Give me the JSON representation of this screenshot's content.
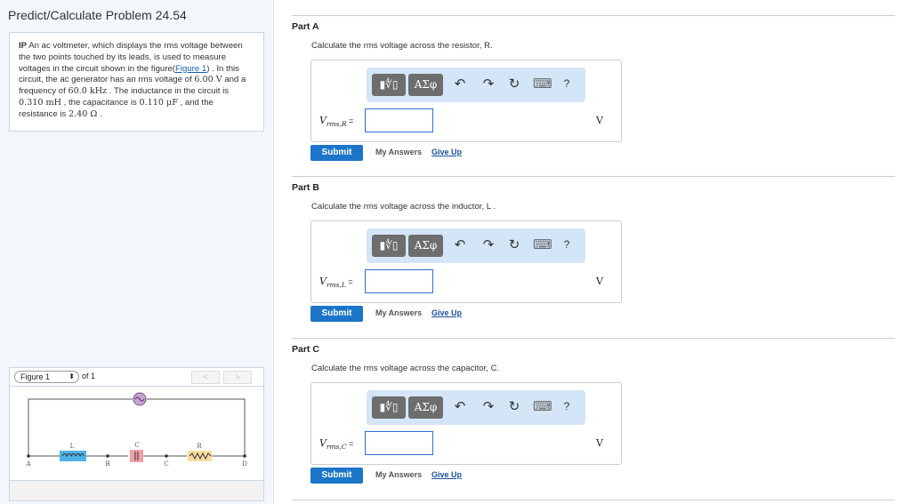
{
  "title": "Predict/Calculate Problem 24.54",
  "problem": {
    "prefix": "IP",
    "t1": " An ac voltmeter, which displays the rms voltage between the two points touched by its leads, is used to measure voltages in the circuit shown in the figure(",
    "link": "Figure 1",
    "t2": ") . In this circuit, the ac generator has an rms voltage of ",
    "v": "6.00 V",
    "t3": " and a frequency of ",
    "f": "60.0 kHz",
    "t4": " . The inductance in the circuit is ",
    "L": "0.310 mH",
    "t5": " , the capacitance is ",
    "C": "0.110 μF",
    "t6": " , and the resistance is ",
    "R": "2.40 Ω",
    "t7": " ."
  },
  "figure": {
    "select": "Figure 1",
    "of": "of 1",
    "prev": "<",
    "next": ">",
    "labels": {
      "L": "L",
      "C": "C",
      "R": "R",
      "A": "A",
      "B": "B",
      "Cn": "C",
      "D": "D"
    }
  },
  "toolbar": {
    "templates": "▮∜▯",
    "greek": "ΑΣφ",
    "undo": "↶",
    "redo": "↷",
    "reset": "↻",
    "keyboard": "⌨",
    "help": "?"
  },
  "parts": [
    {
      "label": "Part A",
      "question": "Calculate the rms voltage across the resistor, R.",
      "var": "V",
      "sub": "rms,R",
      "eq": " =",
      "value": "",
      "unit": "V"
    },
    {
      "label": "Part B",
      "question": "Calculate the rms voltage across the inductor, L .",
      "var": "V",
      "sub": "rms,L",
      "eq": " =",
      "value": "",
      "unit": "V"
    },
    {
      "label": "Part C",
      "question": "Calculate the rms voltage across the capacitor, C.",
      "var": "V",
      "sub": "rms,C",
      "eq": " =",
      "value": "",
      "unit": "V"
    }
  ],
  "buttons": {
    "submit": "Submit",
    "my_answers": "My Answers",
    "give_up": "Give Up"
  }
}
